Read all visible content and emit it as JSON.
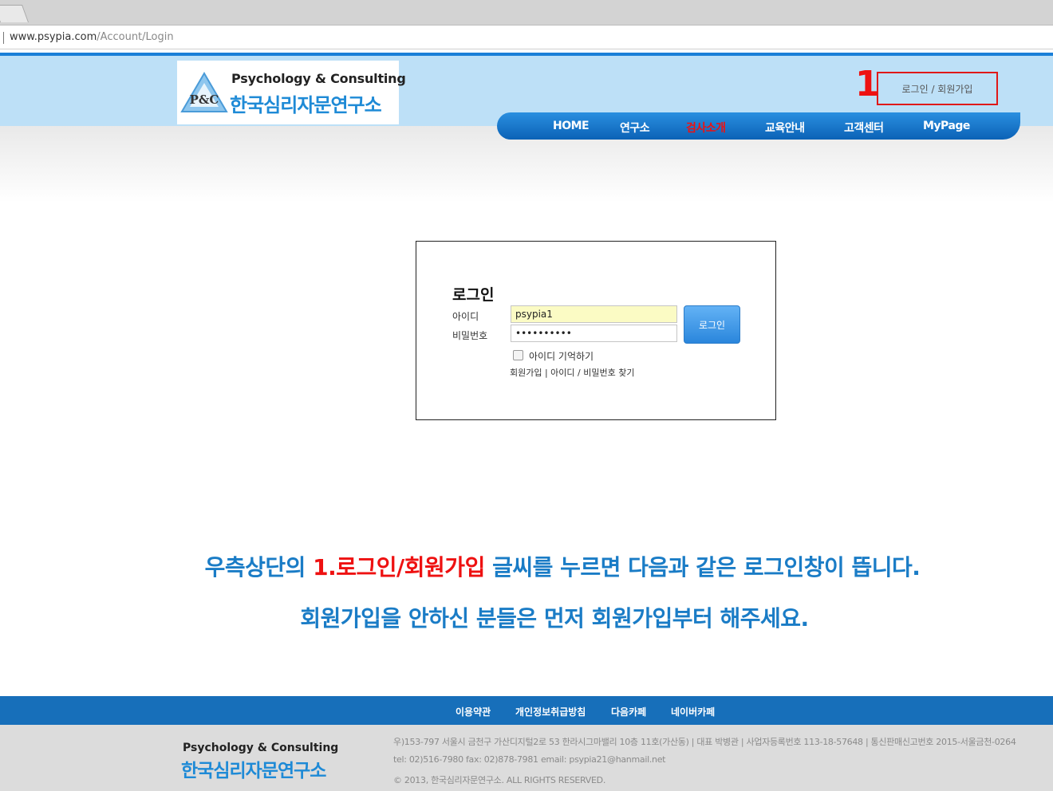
{
  "browser": {
    "url_host": "www.psypia.com",
    "url_path": "/Account/Login"
  },
  "header": {
    "logo_mark": "P&C",
    "logo_en": "Psychology & Consulting",
    "logo_ko": "한국심리자문연구소",
    "annotation_marker": "1",
    "login_join_link": "로그인 / 회원가입",
    "nav": [
      {
        "label": "HOME"
      },
      {
        "label": "연구소"
      },
      {
        "label": "검사소개",
        "active": true
      },
      {
        "label": "교육안내"
      },
      {
        "label": "고객센터"
      },
      {
        "label": "MyPage"
      }
    ]
  },
  "login": {
    "title": "로그인",
    "id_label": "아이디",
    "id_value": "psypia1",
    "password_label": "비밀번호",
    "password_value": "••••••••••",
    "submit_label": "로그인",
    "remember_label": "아이디 기억하기",
    "remember_checked": false,
    "links": "회원가입 | 아이디 / 비밀번호 찾기"
  },
  "instruction": {
    "line1_before": "우측상단의 ",
    "line1_highlight": "1.로그인/회원가입",
    "line1_after": " 글씨를 누르면 다음과 같은 로그인창이 뜹니다.",
    "line2": "회원가입을 안하신 분들은 먼저 회원가입부터 해주세요."
  },
  "footer": {
    "links": [
      "이용약관",
      "개인정보취급방침",
      "다음카페",
      "네이버카페"
    ],
    "logo_en": "Psychology & Consulting",
    "logo_ko": "한국심리자문연구소",
    "address": "우)153-797 서울시 금천구 가산디지털2로 53 한라시그마밸리 10층 11호(가산동) | 대표 박병관 | 사업자등록번호 113-18-57648 | 통신판매신고번호 2015-서울금천-0264",
    "contact": "tel: 02)516-7980 fax: 02)878-7981 email: psypia21@hanmail.net",
    "copyright": "© 2013, 한국심리자문연구소. ALL RIGHTS RESERVED."
  },
  "colors": {
    "brand_blue": "#1e8ad6",
    "nav_blue": "#0b62b6",
    "highlight_red": "#ee1111"
  }
}
